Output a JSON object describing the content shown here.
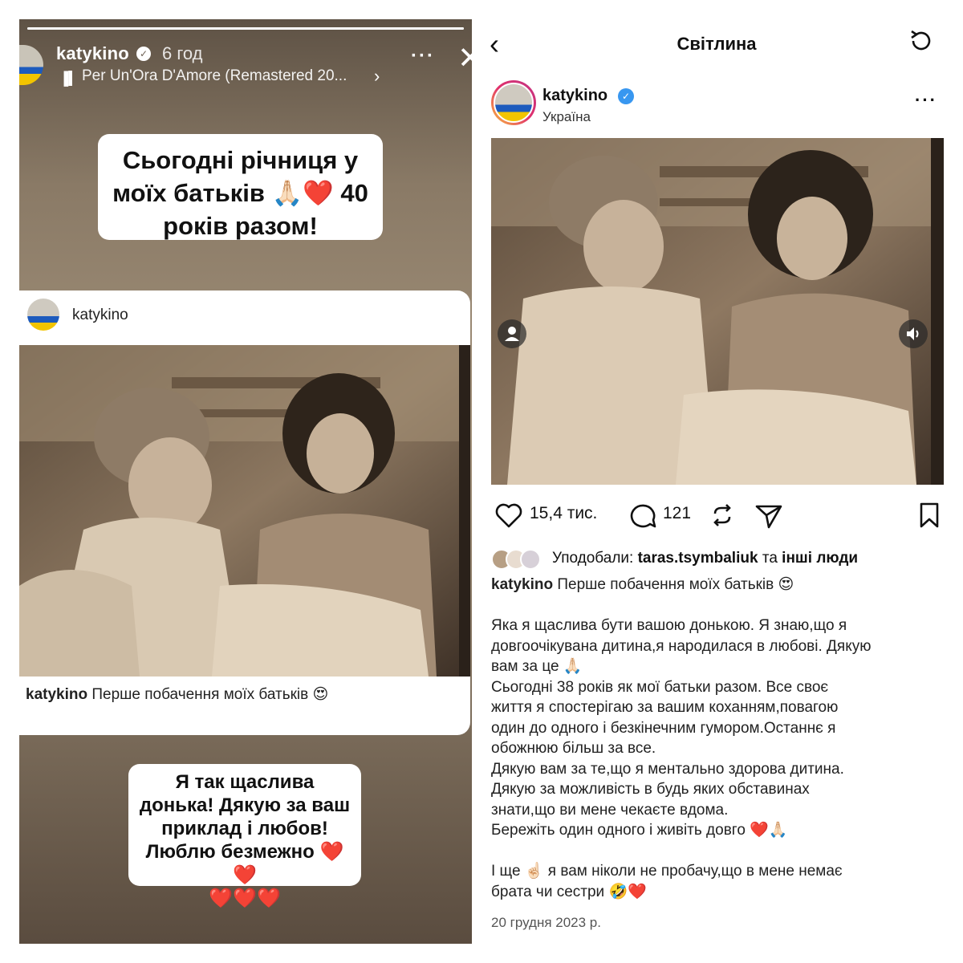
{
  "story": {
    "username": "katykino",
    "time": "6 год",
    "music": "Per Un'Ora D'Amore (Remastered 20...",
    "sticker_top_lines": [
      "Сьогодні річниця у",
      "моїх батьків 🙏🏻❤️ 40",
      "років разом!"
    ],
    "sticker_bottom_lines": [
      "Я так щаслива",
      "донька! Дякую за ваш",
      "приклад і любов!",
      "Люблю безмежно ❤️❤️",
      "❤️❤️❤️"
    ],
    "progress": 1.0,
    "repost": {
      "username": "katykino",
      "caption_user": "katykino",
      "caption_text": "Перше побачення моїх батьків 😍"
    }
  },
  "post": {
    "nav_title": "Світлина",
    "username": "katykino",
    "location": "Україна",
    "likes": "15,4 тис.",
    "comments": "121",
    "liked_prefix": "Уподобали: ",
    "liked_user": "taras.tsymbaliuk",
    "liked_mid": " та ",
    "liked_others": "інші люди",
    "caption_user": "katykino",
    "caption_first": "Перше побачення моїх батьків 😍",
    "caption_lines": [
      "",
      "Яка я щаслива бути вашою донькою. Я знаю,що я",
      "довгоочікувана дитина,я народилася в любові. Дякую",
      "вам за це 🙏🏻",
      "Сьогодні 38 років як мої батьки разом. Все своє",
      "життя я спостерігаю за вашим коханням,повагою",
      "один до одного і безкінечним гумором.Останнє я",
      "обожнюю більш за все.",
      " Дякую вам за те,що я ментально здорова дитина.",
      "Дякую за можливість в будь яких обставинах",
      "знати,що ви мене чекаєте вдома.",
      "Бережіть один одного і живіть довго ❤️🙏🏻",
      "",
      "І ще ☝🏻 я вам ніколи не пробачу,що в мене немає",
      "брата чи сестри 🤣❤️"
    ],
    "date": "20 грудня 2023 р."
  },
  "colors": {
    "verified": "#3897f0",
    "story_bg": "#8a7a66",
    "text": "#111111"
  },
  "icons": [
    "close-icon",
    "more-icon",
    "music-icon",
    "back-icon",
    "refresh-icon",
    "heart-icon",
    "comment-icon",
    "repost-icon",
    "share-icon",
    "bookmark-icon",
    "user-tag-icon",
    "sound-icon"
  ]
}
